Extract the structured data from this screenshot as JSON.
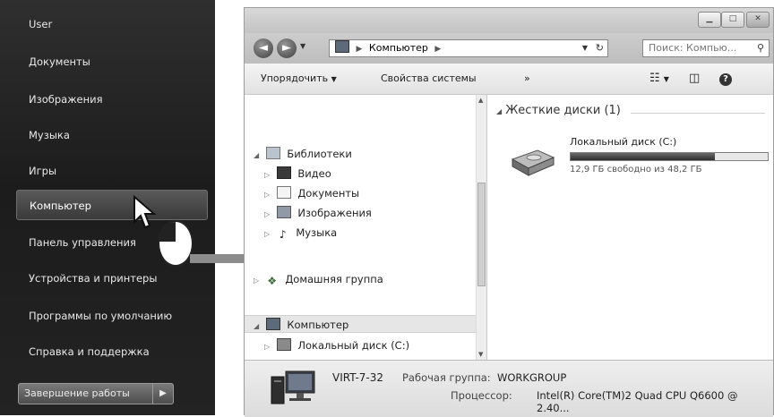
{
  "start_menu": {
    "items": [
      {
        "label": "User"
      },
      {
        "label": "Документы"
      },
      {
        "label": "Изображения"
      },
      {
        "label": "Музыка"
      },
      {
        "label": "Игры"
      },
      {
        "label": "Компьютер",
        "selected": true
      },
      {
        "label": "Панель управления"
      },
      {
        "label": "Устройства и принтеры"
      },
      {
        "label": "Программы по умолчанию"
      },
      {
        "label": "Справка и поддержка"
      }
    ],
    "shutdown_label": "Завершение работы"
  },
  "explorer": {
    "breadcrumb": "Компьютер",
    "search_placeholder": "Поиск: Компью...",
    "toolbar": {
      "organize": "Упорядочить",
      "system_properties": "Свойства системы",
      "more": "»"
    },
    "nav": {
      "libraries": "Библиотеки",
      "library_items": [
        "Видео",
        "Документы",
        "Изображения",
        "Музыка"
      ],
      "homegroup": "Домашняя группа",
      "computer": "Компьютер",
      "local_disk": "Локальный диск (C:)"
    },
    "content": {
      "group_header": "Жесткие диски (1)",
      "drive_name": "Локальный диск (C:)",
      "drive_used_fraction": 0.73,
      "drive_free_text": "12,9 ГБ свободно из 48,2 ГБ"
    },
    "details": {
      "computer_name": "VIRT-7-32",
      "workgroup_label": "Рабочая группа:",
      "workgroup_value": "WORKGROUP",
      "cpu_label": "Процессор:",
      "cpu_value": "Intel(R) Core(TM)2 Quad CPU   Q6600  @ 2.40..."
    }
  },
  "colors": {
    "accent_arrow": "#8c8c8c",
    "start_menu_bg": "#232323"
  }
}
